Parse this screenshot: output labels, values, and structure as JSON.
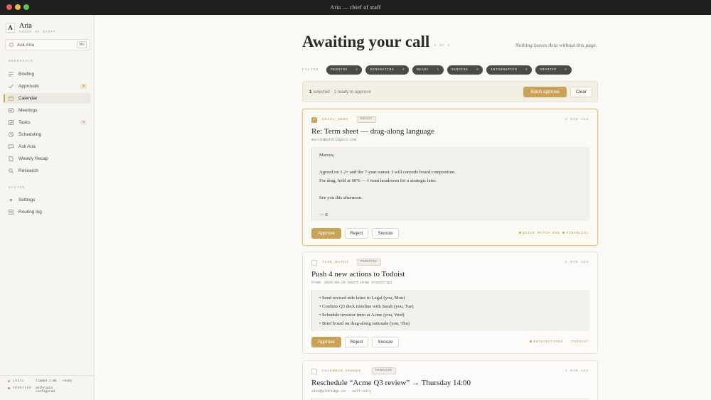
{
  "window": {
    "title": "Aria — chief of staff"
  },
  "sidebar": {
    "logo_letter": "A",
    "app_name": "Aria",
    "app_subtitle": "CHIEF OF STAFF",
    "ask": {
      "label": "Ask Aria",
      "shortcut": "⌘K"
    },
    "workspace_label": "WORKSPACE",
    "workspace_items": [
      {
        "label": "Briefing",
        "icon": "lines-icon"
      },
      {
        "label": "Approvals",
        "icon": "check-icon",
        "badge": "5"
      },
      {
        "label": "Calendar",
        "icon": "calendar-icon",
        "active": true
      },
      {
        "label": "Meetings",
        "icon": "meetings-icon"
      },
      {
        "label": "Tasks",
        "icon": "tasks-icon",
        "badge": "5"
      },
      {
        "label": "Scheduling",
        "icon": "clock-icon"
      },
      {
        "label": "Ask Aria",
        "icon": "chat-icon"
      },
      {
        "label": "Weekly Recap",
        "icon": "document-icon"
      },
      {
        "label": "Research",
        "icon": "search-icon"
      }
    ],
    "system_label": "SYSTEM",
    "system_items": [
      {
        "label": "Settings",
        "icon": "gear-icon"
      },
      {
        "label": "Routing log",
        "icon": "log-icon"
      }
    ],
    "footer": {
      "local_key": "LOCAL",
      "local_value": "llama3.1:8b · ready",
      "frontier_key": "FRONTIER",
      "frontier_value_1": "anthropic",
      "frontier_value_2": "configured"
    }
  },
  "main": {
    "title": "Awaiting your call",
    "count": "1 OF 4",
    "note": "Nothing leaves Aria without this page.",
    "filter_label": "FILTER",
    "filters": [
      {
        "label": "PENDING",
        "count": "3"
      },
      {
        "label": "GENERATING",
        "count": "0"
      },
      {
        "label": "READY",
        "count": "1"
      },
      {
        "label": "SENDING",
        "count": "0"
      },
      {
        "label": "INTERRUPTED",
        "count": "0"
      },
      {
        "label": "SNOOZED",
        "count": "0"
      }
    ],
    "selection": {
      "selected_count": "1",
      "selected_word": "selected",
      "ready_text": "· 1 ready to approve",
      "batch_label": "Batch approve",
      "clear_label": "Clear"
    },
    "buttons": {
      "approve": "Approve",
      "reject": "Reject",
      "snooze": "Snooze"
    },
    "cards": [
      {
        "type": "EMAIL_SEND",
        "status": "READY",
        "age": "2 MIN AGO",
        "title": "Re: Term sheet — drag-along language",
        "meta": "marcus@aldridgeco.com",
        "body": [
          "Marcus,",
          "",
          "Agreed on 1.2× and the 7-year sunset. I will concede board composition.",
          "For drag, hold at 60% — I want headroom for a strategic later.",
          "",
          "See you this afternoon.",
          "",
          "— E"
        ],
        "tag_1": "QUICK MATCH 94%",
        "tag_sep": "·",
        "tag_2": "FINANCIAL"
      },
      {
        "type": "TASK_BATCH",
        "status": "PENDING",
        "age": "2 MIN AGO",
        "title": "Push 4 new actions to Todoist",
        "meta": "From: 2026-04-20 board prep transcript",
        "body": [
          "• Send revised side letter to Legal (you, Mon)",
          "• Confirm Q3 deck timeline with Sarah (you, Tue)",
          "• Schedule investor intro at Acme (you, Wed)",
          "• Brief board on drag-along rationale (you, Thu)"
        ],
        "tag_1": "INTEGRATIONS",
        "tag_sep": "·",
        "tag_2": "TODOIST"
      },
      {
        "type": "CALENDAR_CHANGE",
        "status": "PENDING",
        "age": "2 MIN AGO",
        "title": "Reschedule “Acme Q3 review” → Thursday 14:00",
        "meta": "alex@aldridge.co · self-only"
      }
    ]
  }
}
